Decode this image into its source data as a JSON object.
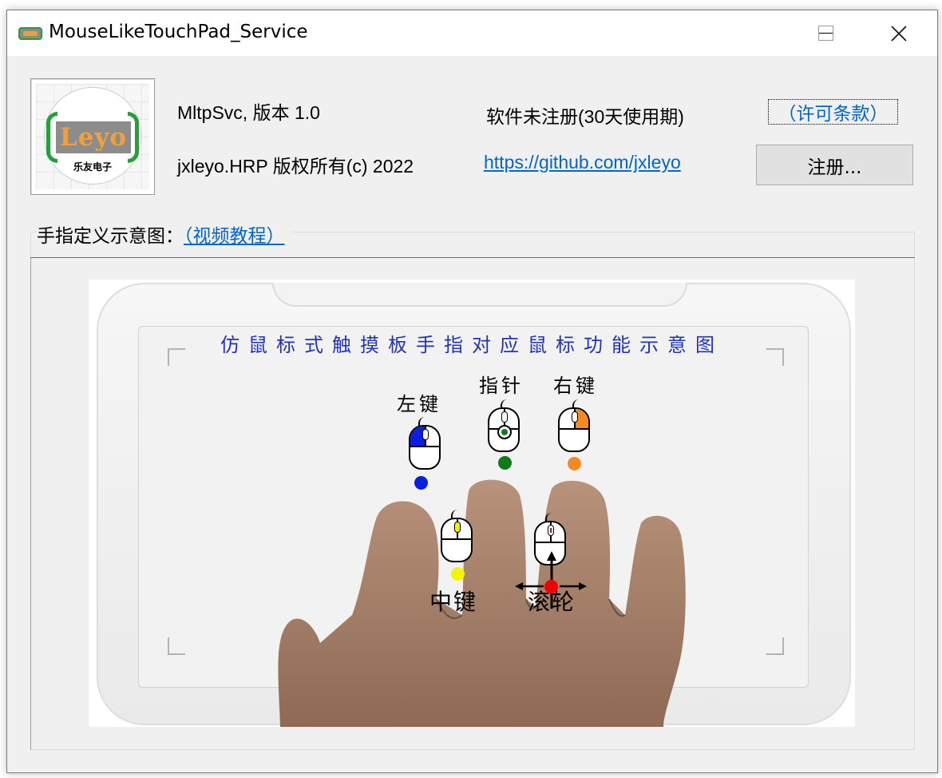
{
  "window": {
    "title": "MouseLikeTouchPad_Service"
  },
  "about": {
    "logo_text": "Leyo",
    "logo_subtext": "乐友电子",
    "version": "MltpSvc, 版本 1.0",
    "copyright": "jxleyo.HRP 版权所有(c) 2022",
    "registration_status": "软件未注册(30天使用期)",
    "github_link": "https://github.com/jxleyo",
    "license_link": "（许可条款）",
    "register_button": "注册..."
  },
  "diagram_section": {
    "label": "手指定义示意图：",
    "video_link": "（视频教程）",
    "title": "仿鼠标式触摸板手指对应鼠标功能示意图",
    "functions": [
      {
        "label": "左键",
        "color": "#0a1ee0"
      },
      {
        "label": "指针",
        "color": "#0f7a1a"
      },
      {
        "label": "右键",
        "color": "#f58a1f"
      },
      {
        "label": "中键",
        "color": "#f5f500"
      },
      {
        "label": "滚轮",
        "color": "#f00000"
      }
    ]
  },
  "icons": {
    "app": "touchpad-app-icon",
    "minimize": "minimize-icon",
    "maximize": "maximize-icon",
    "close": "close-icon"
  }
}
